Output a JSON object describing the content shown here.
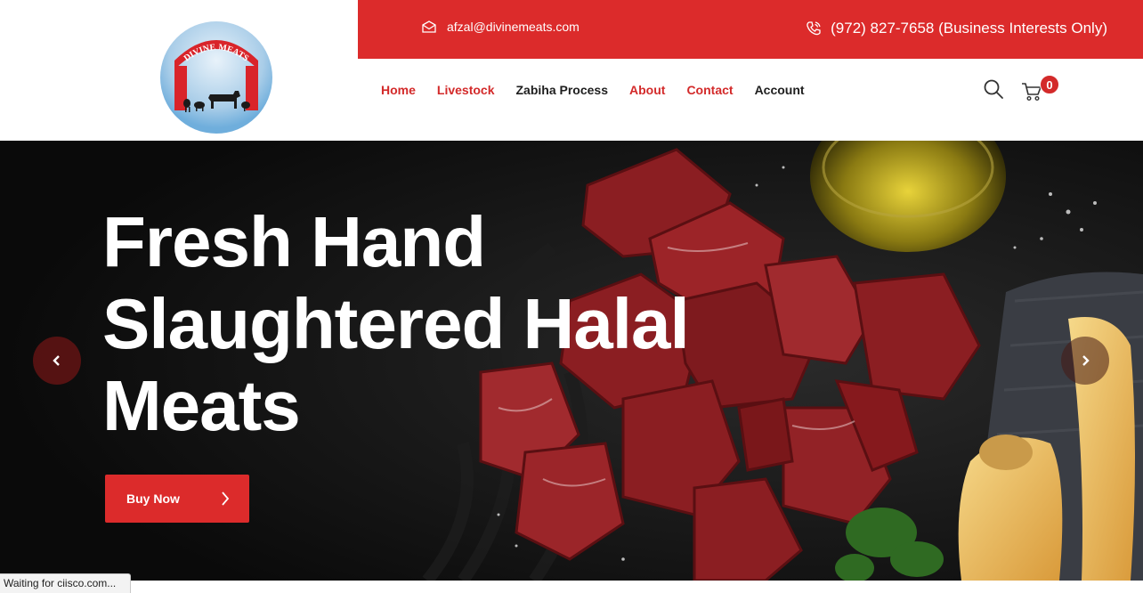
{
  "logo": {
    "text": "DIVINE MEATS"
  },
  "topbar": {
    "email": "afzal@divinemeats.com",
    "phone": "(972) 827-7658 (Business Interests Only)"
  },
  "nav": {
    "items": [
      {
        "label": "Home",
        "color": "#d32a2a"
      },
      {
        "label": "Livestock",
        "color": "#d32a2a"
      },
      {
        "label": "Zabiha Process",
        "color": "#1e1e1e"
      },
      {
        "label": "About",
        "color": "#d32a2a"
      },
      {
        "label": "Contact",
        "color": "#d32a2a"
      },
      {
        "label": "Account",
        "color": "#1e1e1e"
      }
    ]
  },
  "cart": {
    "count": "0"
  },
  "hero": {
    "title_lines": [
      "Fresh Hand",
      "Slaughtered Halal",
      "Meats"
    ],
    "button_label": "Buy Now"
  },
  "status_bar": {
    "text": "Waiting for ciisco.com..."
  },
  "colors": {
    "accent": "#dc2b2b",
    "hero_bg": "#0d0d0d"
  },
  "icons": [
    "email-icon",
    "phone-icon",
    "search-icon",
    "cart-icon",
    "chevron-right-icon",
    "chevron-left-icon"
  ]
}
